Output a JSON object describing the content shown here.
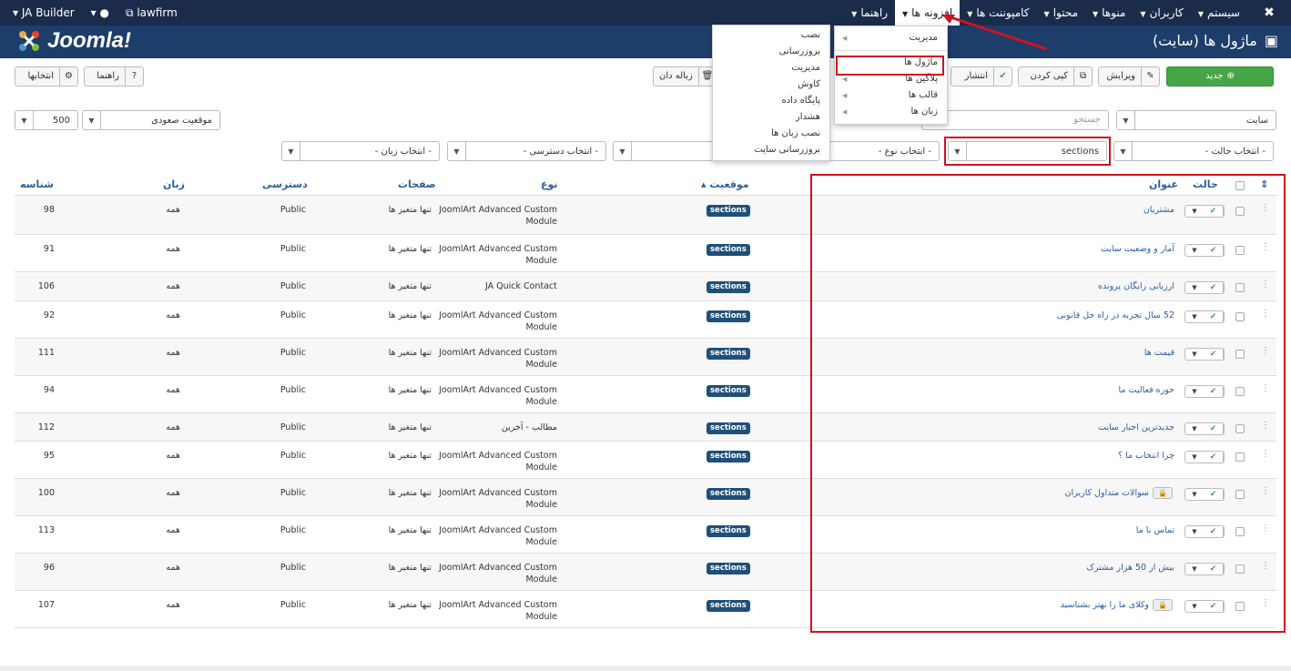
{
  "topbar": {
    "menu": [
      {
        "label": "سیستم",
        "caret": true
      },
      {
        "label": "کاربران",
        "caret": true
      },
      {
        "label": "منوها",
        "caret": true
      },
      {
        "label": "محتوا",
        "caret": true
      },
      {
        "label": "کامپوننت ها",
        "caret": true
      },
      {
        "label": "افزونه ها",
        "caret": true
      },
      {
        "label": "راهنما",
        "caret": true
      }
    ],
    "left": {
      "builder": "JA Builder",
      "user": "▾",
      "site": "lawfirm"
    }
  },
  "header": {
    "logo": "Joomla!",
    "page_title": "ماژول ها (سایت)"
  },
  "toolbar": {
    "new": "جدید",
    "edit": "ویرایش",
    "copy": "کپی کردن",
    "publish": "انتشار",
    "trash": "زباله دان",
    "help": "راهنما",
    "options": "انتخابها"
  },
  "filters": {
    "client": "سایت",
    "search_placeholder": "جستجو",
    "sort": "موقعیت صعودی",
    "limit": "500",
    "state": "- انتخاب حالت -",
    "position": "sections",
    "type": "- انتخاب نوع -",
    "menu": "منو -",
    "access": "- انتخاب دسترسی -",
    "language": "- انتخاب زبان -"
  },
  "columns": {
    "order": "⇕",
    "state": "حالت",
    "title": "عنوان",
    "position": "موقعیت",
    "type": "نوع",
    "pages": "صفحات",
    "access": "دسترسی",
    "language": "زبان",
    "id": "شناسه"
  },
  "rows": [
    {
      "title": "مشتریان",
      "position": "sections",
      "type": [
        "JoomlArt Advanced Custom",
        "Module"
      ],
      "pages": "تنها متغیر ها",
      "access": "Public",
      "language": "همه",
      "id": "98",
      "locked": false
    },
    {
      "title": "آمار و وضعیت سایت",
      "position": "sections",
      "type": [
        "JoomlArt Advanced Custom",
        "Module"
      ],
      "pages": "تنها متغیر ها",
      "access": "Public",
      "language": "همه",
      "id": "91",
      "locked": false
    },
    {
      "title": "ارزیابی رایگان پرونده",
      "position": "sections",
      "type": [
        "JA Quick Contact"
      ],
      "pages": "تنها متغیر ها",
      "access": "Public",
      "language": "همه",
      "id": "106",
      "locked": false
    },
    {
      "title": "52 سال تجربه در راه حل قانونی",
      "position": "sections",
      "type": [
        "JoomlArt Advanced Custom",
        "Module"
      ],
      "pages": "تنها متغیر ها",
      "access": "Public",
      "language": "همه",
      "id": "92",
      "locked": false
    },
    {
      "title": "قیمت ها",
      "position": "sections",
      "type": [
        "JoomlArt Advanced Custom",
        "Module"
      ],
      "pages": "تنها متغیر ها",
      "access": "Public",
      "language": "همه",
      "id": "111",
      "locked": false
    },
    {
      "title": "حوزه فعالیت ما",
      "position": "sections",
      "type": [
        "JoomlArt Advanced Custom",
        "Module"
      ],
      "pages": "تنها متغیر ها",
      "access": "Public",
      "language": "همه",
      "id": "94",
      "locked": false
    },
    {
      "title": "جدیدترین اخبار سایت",
      "position": "sections",
      "type": [
        "مطالب - آخرین"
      ],
      "pages": "تنها متغیر ها",
      "access": "Public",
      "language": "همه",
      "id": "112",
      "locked": false
    },
    {
      "title": "چرا انتخاب ما ؟",
      "position": "sections",
      "type": [
        "JoomlArt Advanced Custom",
        "Module"
      ],
      "pages": "تنها متغیر ها",
      "access": "Public",
      "language": "همه",
      "id": "95",
      "locked": false
    },
    {
      "title": "سوالات متداول کاربران",
      "position": "sections",
      "type": [
        "JoomlArt Advanced Custom",
        "Module"
      ],
      "pages": "تنها متغیر ها",
      "access": "Public",
      "language": "همه",
      "id": "100",
      "locked": true
    },
    {
      "title": "تماس با ما",
      "position": "sections",
      "type": [
        "JoomlArt Advanced Custom",
        "Module"
      ],
      "pages": "تنها متغیر ها",
      "access": "Public",
      "language": "همه",
      "id": "113",
      "locked": false
    },
    {
      "title": "بیش از 50 هزار مشترک",
      "position": "sections",
      "type": [
        "JoomlArt Advanced Custom",
        "Module"
      ],
      "pages": "تنها متغیر ها",
      "access": "Public",
      "language": "همه",
      "id": "96",
      "locked": false
    },
    {
      "title": "وکلای ما را بهتر بشناسید",
      "position": "sections",
      "type": [
        "JoomlArt Advanced Custom",
        "Module"
      ],
      "pages": "تنها متغیر ها",
      "access": "Public",
      "language": "همه",
      "id": "107",
      "locked": true
    }
  ],
  "extensions_menu": [
    {
      "label": "مدیریت",
      "sub": true
    },
    {
      "label": "ماژول ها",
      "sub": false,
      "highlight": true
    },
    {
      "label": "پلاگین ها",
      "sub": true
    },
    {
      "label": "قالب ها",
      "sub": true
    },
    {
      "label": "زبان ها",
      "sub": true
    }
  ],
  "submenu": [
    "نصب",
    "بروزرسانی",
    "مدیریت",
    "کاوش",
    "پایگاه داده",
    "هشدار",
    "نصب زبان ها",
    "بروزرسانی سایت"
  ],
  "colors": {
    "topbar": "#1b2b4a",
    "header": "#1d3d6a",
    "accent": "#d0121f",
    "badge": "#1f4f7a",
    "green": "#46a546"
  }
}
